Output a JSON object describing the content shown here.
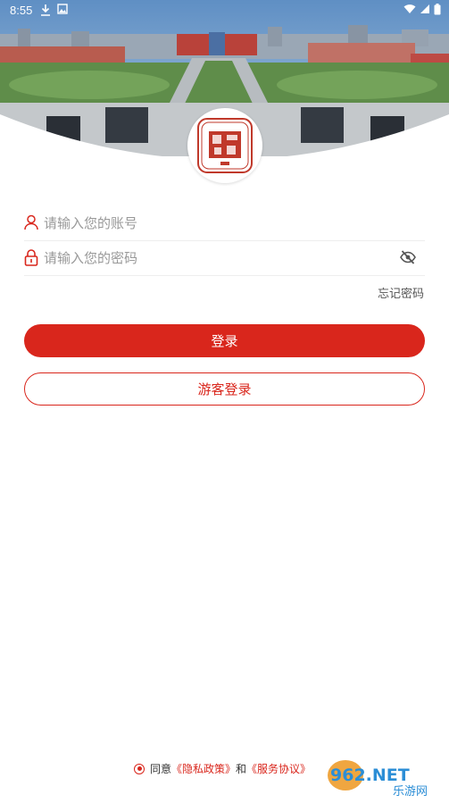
{
  "status_bar": {
    "time": "8:55"
  },
  "login": {
    "account_placeholder": "请输入您的账号",
    "password_placeholder": "请输入您的密码",
    "forgot_label": "忘记密码",
    "login_label": "登录",
    "guest_label": "游客登录"
  },
  "agreement": {
    "prefix": "同意",
    "privacy_link": "《隐私政策》",
    "and": "和",
    "service_link": "《服务协议》"
  },
  "watermark": {
    "text": "962.NET",
    "sub": "乐游网"
  },
  "colors": {
    "accent": "#d9261c",
    "divider": "#eeeeee",
    "placeholder": "#999999"
  }
}
